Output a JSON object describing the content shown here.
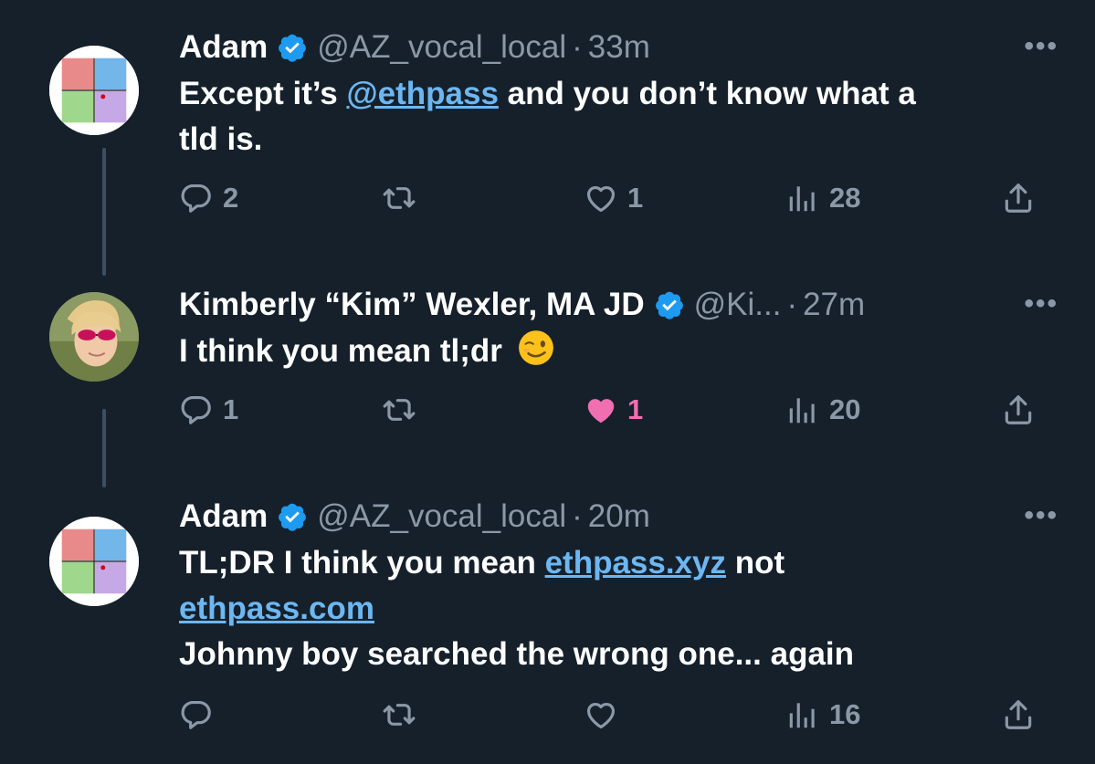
{
  "tweets": [
    {
      "name": "Adam",
      "handle": "@AZ_vocal_local",
      "separator": "·",
      "time": "33m",
      "more": "•••",
      "text_parts": [
        "Except it’s ",
        "@ethpass",
        " and you don’t know what a",
        "tld is."
      ],
      "replies": "2",
      "retweets": "",
      "likes": "1",
      "views": "28",
      "liked": false
    },
    {
      "name": "Kimberly “Kim” Wexler, MA JD",
      "handle": "@Ki...",
      "separator": "·",
      "time": "27m",
      "more": "•••",
      "text_parts": [
        "I think you mean tl;dr"
      ],
      "emoji": "winking-face",
      "replies": "1",
      "retweets": "",
      "likes": "1",
      "views": "20",
      "liked": true
    },
    {
      "name": "Adam",
      "handle": "@AZ_vocal_local",
      "separator": "·",
      "time": "20m",
      "more": "•••",
      "text_parts": [
        "TL;DR I think you mean ",
        "ethpass.xyz",
        " not",
        "ethpass.com",
        "Johnny boy searched the wrong one... again"
      ],
      "replies": "",
      "retweets": "",
      "likes": "",
      "views": "16",
      "liked": false
    }
  ],
  "colors": {
    "background": "#15202b",
    "secondary_text": "#8b98a5",
    "link": "#6cb7f2",
    "like_active": "#f06fb1",
    "verified": "#1d9bf0"
  }
}
